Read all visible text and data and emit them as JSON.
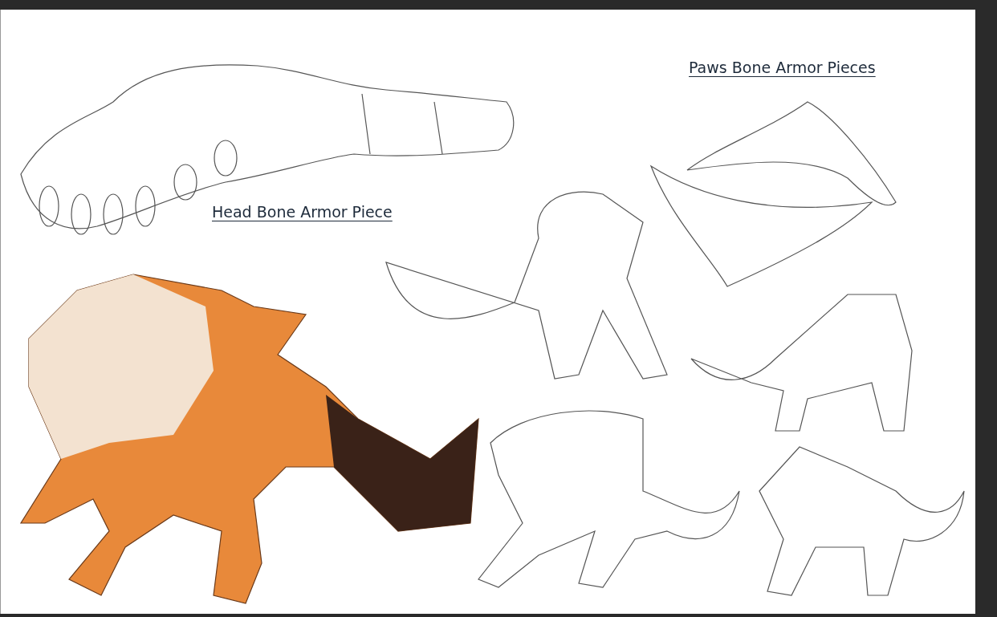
{
  "page": {
    "headings": [
      {
        "text": "Paws Bone Armor Pieces"
      },
      {
        "text": "Head Bone Armor Piece"
      }
    ]
  }
}
